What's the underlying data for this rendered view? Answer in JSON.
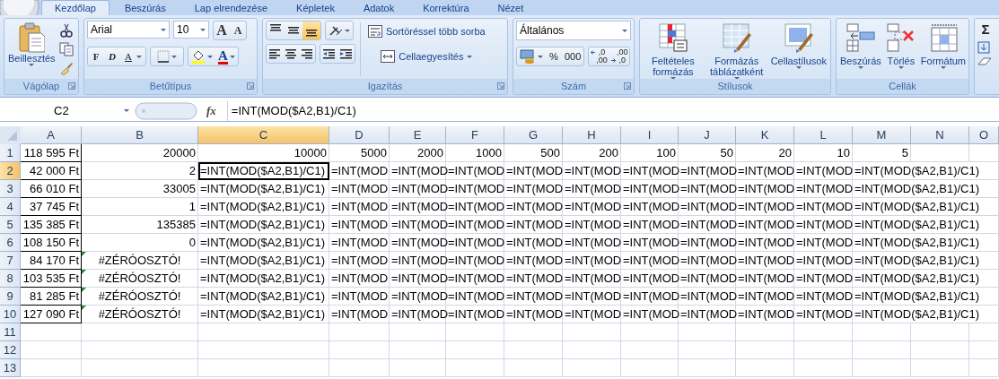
{
  "ribbon": {
    "tabs": [
      {
        "label": "Kezdőlap",
        "selected": true
      },
      {
        "label": "Beszúrás",
        "selected": false
      },
      {
        "label": "Lap elrendezése",
        "selected": false
      },
      {
        "label": "Képletek",
        "selected": false
      },
      {
        "label": "Adatok",
        "selected": false
      },
      {
        "label": "Korrektúra",
        "selected": false
      },
      {
        "label": "Nézet",
        "selected": false
      }
    ],
    "groups": [
      {
        "kind": "clipboard",
        "label": "Vágólap",
        "paste": "Beillesztés"
      },
      {
        "kind": "font",
        "label": "Betűtípus",
        "font": "Arial",
        "size": "10",
        "grow": "A",
        "shrink": "A",
        "bold": "F",
        "italic": "D",
        "underline": "A",
        "font_color": "A"
      },
      {
        "kind": "alignment",
        "label": "Igazítás",
        "vertical_align": [
          {
            "selected": false
          },
          {
            "selected": false
          },
          {
            "selected": true
          }
        ],
        "horizontal_align": [
          {
            "selected": false
          },
          {
            "selected": false
          },
          {
            "selected": false
          }
        ],
        "wrap": "Sortöréssel több sorba",
        "merge": "Cellaegyesítés"
      },
      {
        "kind": "number",
        "label": "Szám",
        "format": "Általános",
        "percent": "%",
        "thousands": "000",
        "decimals": [
          {
            "top": ",0",
            "bottom": ",00"
          },
          {
            "top": ",00",
            "bottom": ",0"
          }
        ]
      },
      {
        "kind": "styles",
        "label": "Stílusok",
        "buttons": [
          {
            "label": "Feltételes formázás"
          },
          {
            "label": "Formázás táblázatként"
          },
          {
            "label": "Cellastílusok"
          }
        ]
      },
      {
        "kind": "cells",
        "label": "Cellák",
        "buttons": [
          {
            "label": "Beszúrás"
          },
          {
            "label": "Törlés"
          },
          {
            "label": "Formátum"
          }
        ]
      },
      {
        "kind": "editing",
        "sum": "Σ"
      }
    ]
  },
  "formula_bar": {
    "name_box": "C2",
    "fx": "fx",
    "formula": "=INT(MOD($A2,B1)/C1)"
  },
  "sheet": {
    "columns": [
      {
        "label": "A",
        "selected": false
      },
      {
        "label": "B",
        "selected": false
      },
      {
        "label": "C",
        "selected": true
      },
      {
        "label": "D",
        "selected": false
      },
      {
        "label": "E",
        "selected": false
      },
      {
        "label": "F",
        "selected": false
      },
      {
        "label": "G",
        "selected": false
      },
      {
        "label": "H",
        "selected": false
      },
      {
        "label": "I",
        "selected": false
      },
      {
        "label": "J",
        "selected": false
      },
      {
        "label": "K",
        "selected": false
      },
      {
        "label": "L",
        "selected": false
      },
      {
        "label": "M",
        "selected": false
      },
      {
        "label": "N",
        "selected": false
      },
      {
        "label": "O",
        "selected": false
      }
    ],
    "rows": [
      {
        "label": "1",
        "selected": false,
        "cells": [
          {
            "text": "118 595 Ft",
            "kind": "currency",
            "selected": false
          },
          {
            "text": "20000",
            "kind": "number",
            "selected": false
          },
          {
            "text": "10000",
            "kind": "number",
            "selected": false
          },
          {
            "text": "5000",
            "kind": "number",
            "selected": false
          },
          {
            "text": "2000",
            "kind": "number",
            "selected": false
          },
          {
            "text": "1000",
            "kind": "number",
            "selected": false
          },
          {
            "text": "500",
            "kind": "number",
            "selected": false
          },
          {
            "text": "200",
            "kind": "number",
            "selected": false
          },
          {
            "text": "100",
            "kind": "number",
            "selected": false
          },
          {
            "text": "50",
            "kind": "number",
            "selected": false
          },
          {
            "text": "20",
            "kind": "number",
            "selected": false
          },
          {
            "text": "10",
            "kind": "number",
            "selected": false
          },
          {
            "text": "5",
            "kind": "number",
            "selected": false
          }
        ]
      },
      {
        "label": "2",
        "selected": true,
        "cells": [
          {
            "text": "42 000 Ft",
            "kind": "currency",
            "selected": false
          },
          {
            "text": "2",
            "kind": "number",
            "selected": false
          },
          {
            "text": "=INT(MOD($A2,B1)/C1)",
            "kind": "formula",
            "selected": true
          },
          {
            "text": "=INT(MOD",
            "kind": "formula",
            "selected": false
          },
          {
            "text": "=INT(MOD",
            "kind": "formula",
            "selected": false
          },
          {
            "text": "=INT(MOD",
            "kind": "formula",
            "selected": false
          },
          {
            "text": "=INT(MOD",
            "kind": "formula",
            "selected": false
          },
          {
            "text": "=INT(MOD",
            "kind": "formula",
            "selected": false
          },
          {
            "text": "=INT(MOD",
            "kind": "formula",
            "selected": false
          },
          {
            "text": "=INT(MOD",
            "kind": "formula",
            "selected": false
          },
          {
            "text": "=INT(MOD",
            "kind": "formula",
            "selected": false
          },
          {
            "text": "=INT(MOD",
            "kind": "formula",
            "selected": false
          },
          {
            "text": "=INT(MOD($A2,B1)/C1)",
            "kind": "formula",
            "selected": false
          }
        ]
      },
      {
        "label": "3",
        "selected": false,
        "cells": [
          {
            "text": "66 010 Ft",
            "kind": "currency",
            "selected": false
          },
          {
            "text": "33005",
            "kind": "number",
            "selected": false
          },
          {
            "text": "=INT(MOD($A2,B1)/C1)",
            "kind": "formula",
            "selected": false
          },
          {
            "text": "=INT(MOD",
            "kind": "formula",
            "selected": false
          },
          {
            "text": "=INT(MOD",
            "kind": "formula",
            "selected": false
          },
          {
            "text": "=INT(MOD",
            "kind": "formula",
            "selected": false
          },
          {
            "text": "=INT(MOD",
            "kind": "formula",
            "selected": false
          },
          {
            "text": "=INT(MOD",
            "kind": "formula",
            "selected": false
          },
          {
            "text": "=INT(MOD",
            "kind": "formula",
            "selected": false
          },
          {
            "text": "=INT(MOD",
            "kind": "formula",
            "selected": false
          },
          {
            "text": "=INT(MOD",
            "kind": "formula",
            "selected": false
          },
          {
            "text": "=INT(MOD",
            "kind": "formula",
            "selected": false
          },
          {
            "text": "=INT(MOD($A2,B1)/C1)",
            "kind": "formula",
            "selected": false
          }
        ]
      },
      {
        "label": "4",
        "selected": false,
        "cells": [
          {
            "text": "37 745 Ft",
            "kind": "currency",
            "selected": false
          },
          {
            "text": "1",
            "kind": "number",
            "selected": false
          },
          {
            "text": "=INT(MOD($A2,B1)/C1)",
            "kind": "formula",
            "selected": false
          },
          {
            "text": "=INT(MOD",
            "kind": "formula",
            "selected": false
          },
          {
            "text": "=INT(MOD",
            "kind": "formula",
            "selected": false
          },
          {
            "text": "=INT(MOD",
            "kind": "formula",
            "selected": false
          },
          {
            "text": "=INT(MOD",
            "kind": "formula",
            "selected": false
          },
          {
            "text": "=INT(MOD",
            "kind": "formula",
            "selected": false
          },
          {
            "text": "=INT(MOD",
            "kind": "formula",
            "selected": false
          },
          {
            "text": "=INT(MOD",
            "kind": "formula",
            "selected": false
          },
          {
            "text": "=INT(MOD",
            "kind": "formula",
            "selected": false
          },
          {
            "text": "=INT(MOD",
            "kind": "formula",
            "selected": false
          },
          {
            "text": "=INT(MOD($A2,B1)/C1)",
            "kind": "formula",
            "selected": false
          }
        ]
      },
      {
        "label": "5",
        "selected": false,
        "cells": [
          {
            "text": "135 385 Ft",
            "kind": "currency",
            "selected": false
          },
          {
            "text": "135385",
            "kind": "number",
            "selected": false
          },
          {
            "text": "=INT(MOD($A2,B1)/C1)",
            "kind": "formula",
            "selected": false
          },
          {
            "text": "=INT(MOD",
            "kind": "formula",
            "selected": false
          },
          {
            "text": "=INT(MOD",
            "kind": "formula",
            "selected": false
          },
          {
            "text": "=INT(MOD",
            "kind": "formula",
            "selected": false
          },
          {
            "text": "=INT(MOD",
            "kind": "formula",
            "selected": false
          },
          {
            "text": "=INT(MOD",
            "kind": "formula",
            "selected": false
          },
          {
            "text": "=INT(MOD",
            "kind": "formula",
            "selected": false
          },
          {
            "text": "=INT(MOD",
            "kind": "formula",
            "selected": false
          },
          {
            "text": "=INT(MOD",
            "kind": "formula",
            "selected": false
          },
          {
            "text": "=INT(MOD",
            "kind": "formula",
            "selected": false
          },
          {
            "text": "=INT(MOD($A2,B1)/C1)",
            "kind": "formula",
            "selected": false
          }
        ]
      },
      {
        "label": "6",
        "selected": false,
        "cells": [
          {
            "text": "108 150 Ft",
            "kind": "currency",
            "selected": false
          },
          {
            "text": "0",
            "kind": "number",
            "selected": false
          },
          {
            "text": "=INT(MOD($A2,B1)/C1)",
            "kind": "formula",
            "selected": false
          },
          {
            "text": "=INT(MOD",
            "kind": "formula",
            "selected": false
          },
          {
            "text": "=INT(MOD",
            "kind": "formula",
            "selected": false
          },
          {
            "text": "=INT(MOD",
            "kind": "formula",
            "selected": false
          },
          {
            "text": "=INT(MOD",
            "kind": "formula",
            "selected": false
          },
          {
            "text": "=INT(MOD",
            "kind": "formula",
            "selected": false
          },
          {
            "text": "=INT(MOD",
            "kind": "formula",
            "selected": false
          },
          {
            "text": "=INT(MOD",
            "kind": "formula",
            "selected": false
          },
          {
            "text": "=INT(MOD",
            "kind": "formula",
            "selected": false
          },
          {
            "text": "=INT(MOD",
            "kind": "formula",
            "selected": false
          },
          {
            "text": "=INT(MOD($A2,B1)/C1)",
            "kind": "formula",
            "selected": false
          }
        ]
      },
      {
        "label": "7",
        "selected": false,
        "cells": [
          {
            "text": "84 170 Ft",
            "kind": "currency",
            "selected": false
          },
          {
            "text": "#ZÉRÓOSZTÓ!",
            "kind": "error",
            "selected": false
          },
          {
            "text": "=INT(MOD($A2,B1)/C1)",
            "kind": "formula",
            "selected": false
          },
          {
            "text": "=INT(MOD",
            "kind": "formula",
            "selected": false
          },
          {
            "text": "=INT(MOD",
            "kind": "formula",
            "selected": false
          },
          {
            "text": "=INT(MOD",
            "kind": "formula",
            "selected": false
          },
          {
            "text": "=INT(MOD",
            "kind": "formula",
            "selected": false
          },
          {
            "text": "=INT(MOD",
            "kind": "formula",
            "selected": false
          },
          {
            "text": "=INT(MOD",
            "kind": "formula",
            "selected": false
          },
          {
            "text": "=INT(MOD",
            "kind": "formula",
            "selected": false
          },
          {
            "text": "=INT(MOD",
            "kind": "formula",
            "selected": false
          },
          {
            "text": "=INT(MOD",
            "kind": "formula",
            "selected": false
          },
          {
            "text": "=INT(MOD($A2,B1)/C1)",
            "kind": "formula",
            "selected": false
          }
        ]
      },
      {
        "label": "8",
        "selected": false,
        "cells": [
          {
            "text": "103 535 Ft",
            "kind": "currency",
            "selected": false
          },
          {
            "text": "#ZÉRÓOSZTÓ!",
            "kind": "error",
            "selected": false
          },
          {
            "text": "=INT(MOD($A2,B1)/C1)",
            "kind": "formula",
            "selected": false
          },
          {
            "text": "=INT(MOD",
            "kind": "formula",
            "selected": false
          },
          {
            "text": "=INT(MOD",
            "kind": "formula",
            "selected": false
          },
          {
            "text": "=INT(MOD",
            "kind": "formula",
            "selected": false
          },
          {
            "text": "=INT(MOD",
            "kind": "formula",
            "selected": false
          },
          {
            "text": "=INT(MOD",
            "kind": "formula",
            "selected": false
          },
          {
            "text": "=INT(MOD",
            "kind": "formula",
            "selected": false
          },
          {
            "text": "=INT(MOD",
            "kind": "formula",
            "selected": false
          },
          {
            "text": "=INT(MOD",
            "kind": "formula",
            "selected": false
          },
          {
            "text": "=INT(MOD",
            "kind": "formula",
            "selected": false
          },
          {
            "text": "=INT(MOD($A2,B1)/C1)",
            "kind": "formula",
            "selected": false
          }
        ]
      },
      {
        "label": "9",
        "selected": false,
        "cells": [
          {
            "text": "81 285 Ft",
            "kind": "currency",
            "selected": false
          },
          {
            "text": "#ZÉRÓOSZTÓ!",
            "kind": "error",
            "selected": false
          },
          {
            "text": "=INT(MOD($A2,B1)/C1)",
            "kind": "formula",
            "selected": false
          },
          {
            "text": "=INT(MOD",
            "kind": "formula",
            "selected": false
          },
          {
            "text": "=INT(MOD",
            "kind": "formula",
            "selected": false
          },
          {
            "text": "=INT(MOD",
            "kind": "formula",
            "selected": false
          },
          {
            "text": "=INT(MOD",
            "kind": "formula",
            "selected": false
          },
          {
            "text": "=INT(MOD",
            "kind": "formula",
            "selected": false
          },
          {
            "text": "=INT(MOD",
            "kind": "formula",
            "selected": false
          },
          {
            "text": "=INT(MOD",
            "kind": "formula",
            "selected": false
          },
          {
            "text": "=INT(MOD",
            "kind": "formula",
            "selected": false
          },
          {
            "text": "=INT(MOD",
            "kind": "formula",
            "selected": false
          },
          {
            "text": "=INT(MOD($A2,B1)/C1)",
            "kind": "formula",
            "selected": false
          }
        ]
      },
      {
        "label": "10",
        "selected": false,
        "cells": [
          {
            "text": "127 090 Ft",
            "kind": "currency",
            "selected": false
          },
          {
            "text": "#ZÉRÓOSZTÓ!",
            "kind": "error",
            "selected": false
          },
          {
            "text": "=INT(MOD($A2,B1)/C1)",
            "kind": "formula",
            "selected": false
          },
          {
            "text": "=INT(MOD",
            "kind": "formula",
            "selected": false
          },
          {
            "text": "=INT(MOD",
            "kind": "formula",
            "selected": false
          },
          {
            "text": "=INT(MOD",
            "kind": "formula",
            "selected": false
          },
          {
            "text": "=INT(MOD",
            "kind": "formula",
            "selected": false
          },
          {
            "text": "=INT(MOD",
            "kind": "formula",
            "selected": false
          },
          {
            "text": "=INT(MOD",
            "kind": "formula",
            "selected": false
          },
          {
            "text": "=INT(MOD",
            "kind": "formula",
            "selected": false
          },
          {
            "text": "=INT(MOD",
            "kind": "formula",
            "selected": false
          },
          {
            "text": "=INT(MOD",
            "kind": "formula",
            "selected": false
          },
          {
            "text": "=INT(MOD($A2,B1)/C1)",
            "kind": "formula",
            "selected": false
          }
        ]
      },
      {
        "label": "11",
        "selected": false,
        "cells": []
      },
      {
        "label": "12",
        "selected": false,
        "cells": []
      },
      {
        "label": "13",
        "selected": false,
        "cells": []
      }
    ]
  }
}
